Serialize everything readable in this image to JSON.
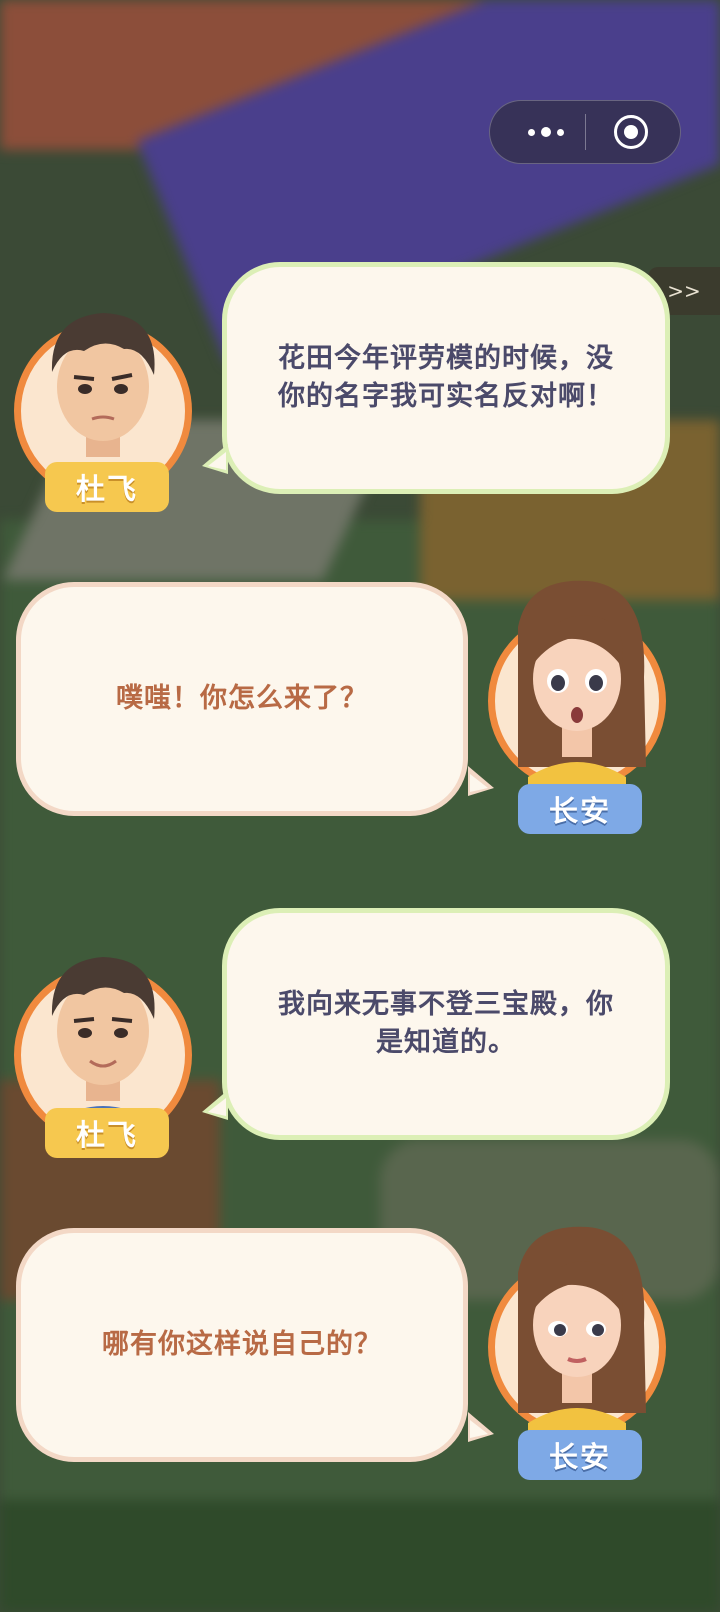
{
  "top_bar": {
    "skip_label": ">>"
  },
  "dialogues": [
    {
      "speaker": "杜飞",
      "text": "花田今年评劳模的时候，没你的名字我可实名反对啊！"
    },
    {
      "speaker": "长安",
      "text": "噗嗤！你怎么来了？"
    },
    {
      "speaker": "杜飞",
      "text": "我向来无事不登三宝殿，你是知道的。"
    },
    {
      "speaker": "长安",
      "text": "哪有你这样说自己的？"
    }
  ],
  "colors": {
    "left_bubble_border": "#dcefb6",
    "right_bubble_border": "#f3d8c6",
    "left_text": "#4b4a6a",
    "right_text": "#b86a45",
    "avatar_ring": "#f08a3e",
    "male_nameplate": "#f6c84f",
    "female_nameplate": "#7ea9e6"
  },
  "icons": [
    "more-dots-icon",
    "close-target-icon",
    "skip-icon"
  ]
}
